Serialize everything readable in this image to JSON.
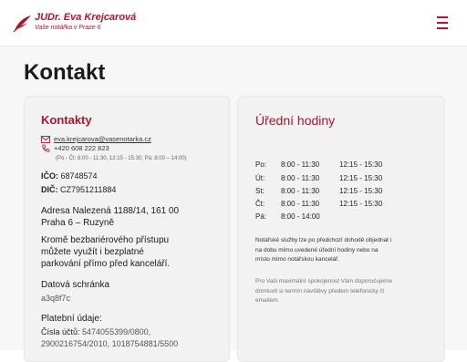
{
  "header": {
    "name": "JUDr. Eva Krejcarová",
    "subtitle": "Vaše notářka v Praze 6",
    "brand_color": "#b2152b"
  },
  "page": {
    "title": "Kontakt"
  },
  "contacts": {
    "title": "Kontakty",
    "email": "eva.krejcarova@vasenotarka.cz",
    "phone": "+420 608 222 823",
    "phone_hours": "(Po - Čt: 8:00 - 11:30, 12:15 - 15:30; Pá: 8:00 – 14:00)",
    "ico_label": "IČO:",
    "ico_value": "68748574",
    "dic_label": "DIČ:",
    "dic_value": "CZ7951211884",
    "address_line1": "Adresa Nalezená 1188/14,  161 00",
    "address_line2": "Praha 6 – Ruzyně",
    "parking_line1": "Kromě bezbariérového přístupu",
    "parking_line2": "můžete využít i bezplatné",
    "parking_line3": "parkování přímo před kanceláří.",
    "databox_label": "Datová schránka",
    "databox_value": "a3q8f7c",
    "payment_label": "Platební údaje:",
    "account_label": "Čísla účtů:",
    "account_line1": " 5474055399/0800,",
    "account_line2": "2900216754/2010, 1018754881/5500"
  },
  "hours": {
    "title": "Úřední hodiny",
    "rows": [
      {
        "day": "Po:",
        "a": "8:00 - 11:30",
        "b": "12:15 - 15:30"
      },
      {
        "day": "Út:",
        "a": "8:00 - 11:30",
        "b": "12:15 - 15:30"
      },
      {
        "day": "St:",
        "a": "8:00 - 11:30",
        "b": "12:15 - 15:30"
      },
      {
        "day": "Čt:",
        "a": "8:00 - 11:30",
        "b": "12:15 - 15:30"
      },
      {
        "day": "Pá:",
        "a": "8:00 - 14:00",
        "b": ""
      }
    ],
    "note1_line1": "Notářské služby lze po předchozí dohodě objednat i",
    "note1_line2": "na dobu mimo uvedené úřední hodiny nebo na",
    "note1_line3": "místo mimo notářskou kancelář.",
    "note2_line1": "Pro Vaši maximální spokojenost Vám doporučujeme",
    "note2_line2": "domluvit si termín návštěvy předem telefonicky či",
    "note2_line3": "emailem."
  }
}
